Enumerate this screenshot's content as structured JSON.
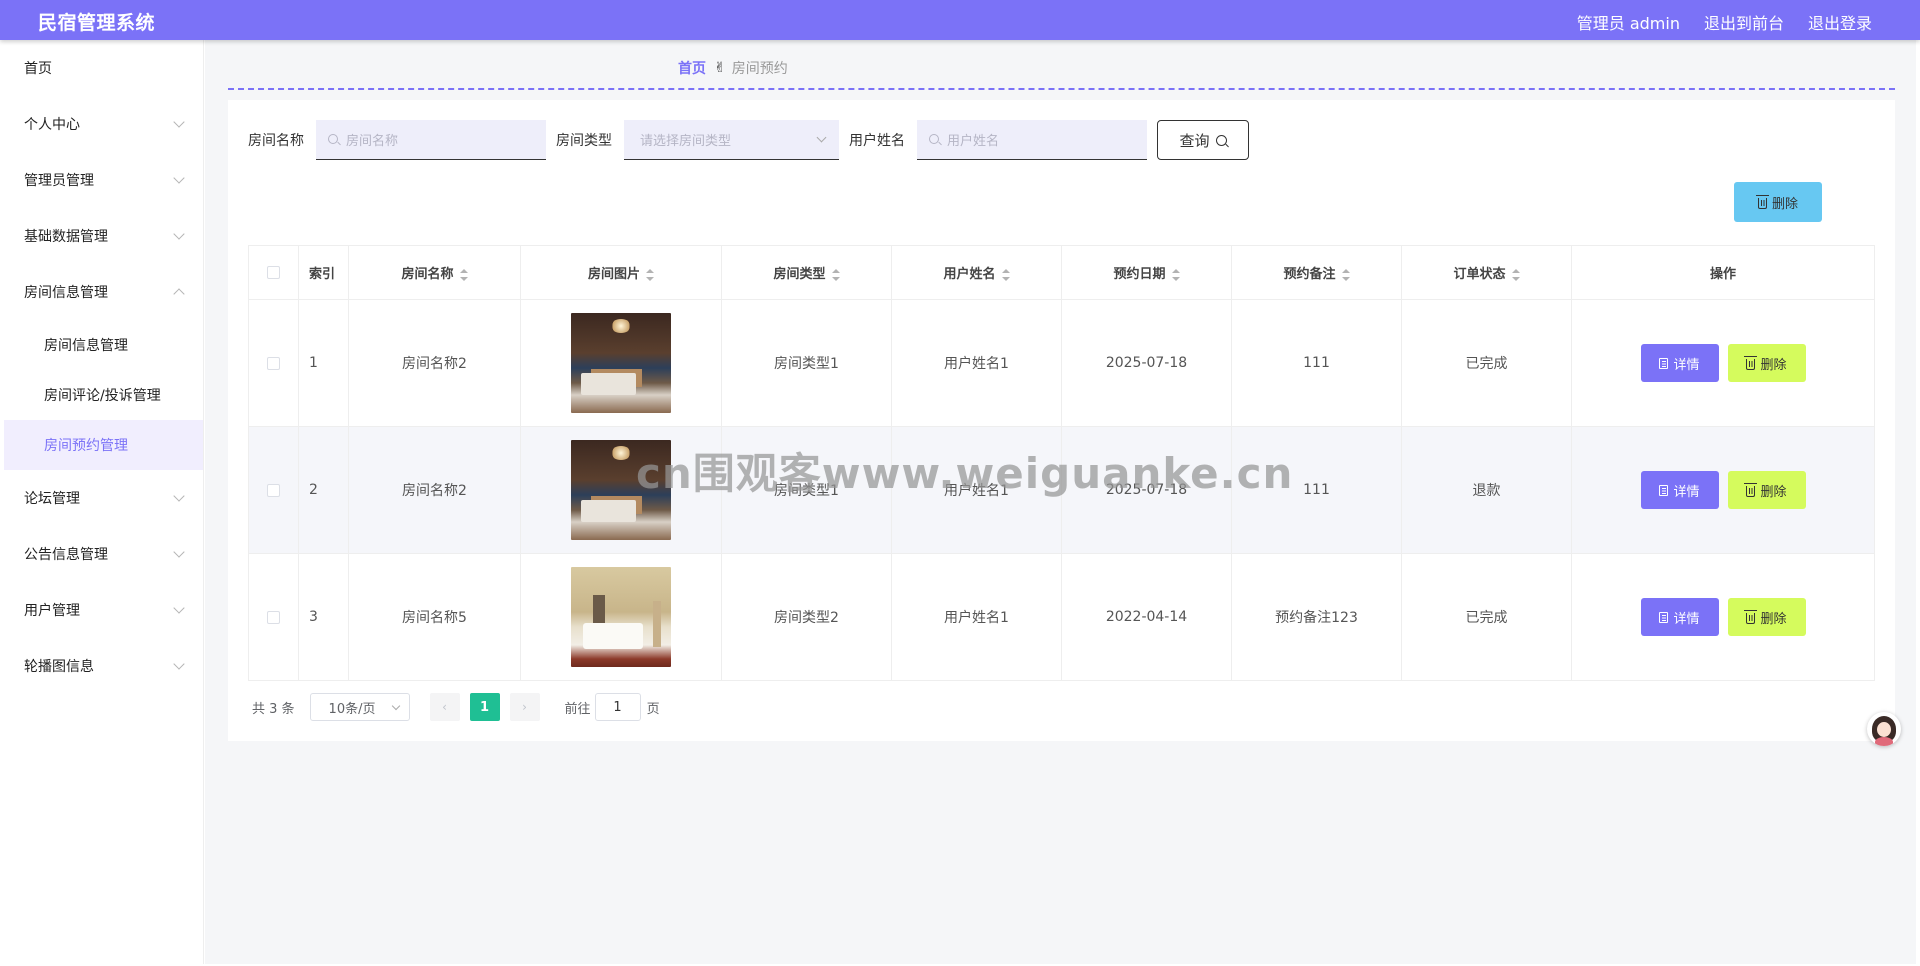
{
  "header": {
    "title": "民宿管理系统",
    "user": "管理员 admin",
    "to_front": "退出到前台",
    "logout": "退出登录"
  },
  "sidebar": {
    "items": [
      {
        "label": "首页"
      },
      {
        "label": "个人中心"
      },
      {
        "label": "管理员管理"
      },
      {
        "label": "基础数据管理"
      },
      {
        "label": "房间信息管理"
      },
      {
        "label": "论坛管理"
      },
      {
        "label": "公告信息管理"
      },
      {
        "label": "用户管理"
      },
      {
        "label": "轮播图信息"
      }
    ],
    "sub_items": [
      {
        "label": "房间信息管理"
      },
      {
        "label": "房间评论/投诉管理"
      },
      {
        "label": "房间预约管理"
      }
    ]
  },
  "breadcrumb": {
    "home": "首页",
    "separator": "✌",
    "current": "房间预约"
  },
  "search": {
    "room_name_label": "房间名称",
    "room_name_placeholder": "房间名称",
    "room_type_label": "房间类型",
    "room_type_placeholder": "请选择房间类型",
    "user_name_label": "用户姓名",
    "user_name_placeholder": "用户姓名",
    "query_button": "查询"
  },
  "toolbar": {
    "delete_label": "删除"
  },
  "table": {
    "columns": [
      "索引",
      "房间名称",
      "房间图片",
      "房间类型",
      "用户姓名",
      "预约日期",
      "预约备注",
      "订单状态",
      "操作"
    ],
    "rows": [
      {
        "index": "1",
        "room_name": "房间名称2",
        "room_type": "房间类型1",
        "user_name": "用户姓名1",
        "date": "2025-07-18",
        "note": "111",
        "status": "已完成"
      },
      {
        "index": "2",
        "room_name": "房间名称2",
        "room_type": "房间类型1",
        "user_name": "用户姓名1",
        "date": "2025-07-18",
        "note": "111",
        "status": "退款"
      },
      {
        "index": "3",
        "room_name": "房间名称5",
        "room_type": "房间类型2",
        "user_name": "用户姓名1",
        "date": "2022-04-14",
        "note": "预约备注123",
        "status": "已完成"
      }
    ],
    "detail_label": "详情",
    "delete_label": "删除"
  },
  "pagination": {
    "total": "共 3 条",
    "page_size": "10条/页",
    "current_page": "1",
    "goto_label": "前往",
    "goto_value": "1",
    "page_suffix": "页"
  },
  "watermark": "cn围观客www.weiguanke.cn",
  "colors": {
    "primary": "#7b72f7",
    "delete_lime": "#d5fb5d",
    "bulk_delete": "#67c8f2",
    "pager_active": "#1fbf94"
  }
}
